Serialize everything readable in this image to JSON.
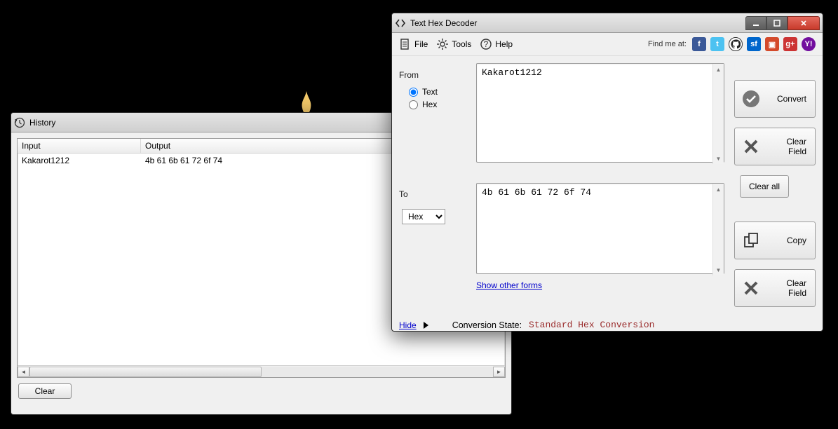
{
  "history": {
    "title": "History",
    "columns": {
      "input": "Input",
      "output": "Output"
    },
    "rows": [
      {
        "input": "Kakarot1212",
        "output": "4b 61 6b 61 72 6f 74"
      }
    ],
    "clear_label": "Clear"
  },
  "main": {
    "title": "Text Hex Decoder",
    "menu": {
      "file": "File",
      "tools": "Tools",
      "help": "Help"
    },
    "findme_label": "Find me at:",
    "from": {
      "label": "From",
      "text_label": "Text",
      "hex_label": "Hex",
      "selected": "text",
      "value": "Kakarot1212"
    },
    "to": {
      "label": "To",
      "selected_option": "Hex",
      "value": "4b 61 6b 61 72 6f 74"
    },
    "buttons": {
      "convert": "Convert",
      "clear_field": "Clear Field",
      "clear_all": "Clear all",
      "copy": "Copy",
      "clear_field2": "Clear Field"
    },
    "show_other_forms": "Show other forms",
    "hide_label": "Hide",
    "conversion_state_label": "Conversion State:",
    "conversion_state_value": "Standard Hex Conversion"
  }
}
